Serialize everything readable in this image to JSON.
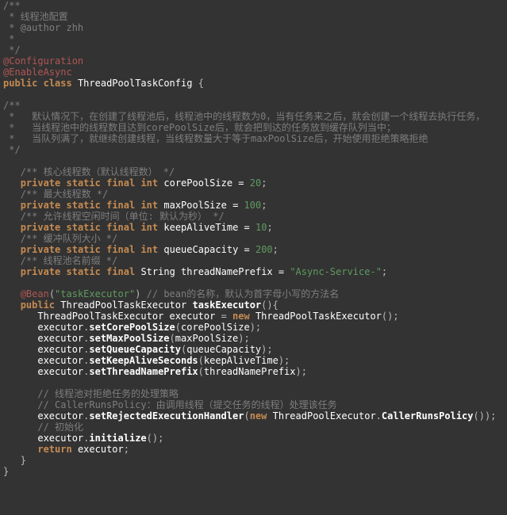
{
  "lines": {
    "c1": "/**",
    "c2": " * 线程池配置",
    "c3": " * @author zhh",
    "c4": " *",
    "c5": " */",
    "ann_conf": "@Configuration",
    "ann_async": "@EnableAsync",
    "kw_public": "public",
    "kw_class": "class",
    "cls_name": "ThreadPoolTaskConfig",
    "brace_o": "{",
    "brace_c": "}",
    "c6": "/**",
    "c7": " *   默认情况下，在创建了线程池后，线程池中的线程数为0，当有任务来之后，就会创建一个线程去执行任务，",
    "c8": " *   当线程池中的线程数目达到corePoolSize后，就会把到达的任务放到缓存队列当中；",
    "c9": " *   当队列满了，就继续创建线程，当线程数量大于等于maxPoolSize后，开始使用拒绝策略拒绝",
    "c10": " */",
    "c_core": "/** 核心线程数（默认线程数） */",
    "kw_private": "private",
    "kw_static": "static",
    "kw_final": "final",
    "ty_int": "int",
    "ty_string": "String",
    "id_core": "corePoolSize",
    "eq": " = ",
    "n20": "20",
    "semi": ";",
    "c_max": "/** 最大线程数 */",
    "id_max": "maxPoolSize",
    "n100": "100",
    "c_alive": "/** 允许线程空闲时间（单位: 默认为秒） */",
    "id_alive": "keepAliveTime",
    "n10": "10",
    "c_queue": "/** 缓冲队列大小 */",
    "id_queue": "queueCapacity",
    "n200": "200",
    "c_prefix": "/** 线程池名前缀 */",
    "id_prefix": "threadNamePrefix",
    "s_prefix": "\"Async-Service-\"",
    "ann_bean": "@Bean",
    "s_bean": "\"taskExecutor\"",
    "c_bean": " // bean的名称，默认为首字母小写的方法名",
    "ret_type": "ThreadPoolTaskExecutor",
    "m_name": "taskExecutor",
    "id_exec": "executor",
    "kw_new": "new",
    "ctor": "ThreadPoolTaskExecutor",
    "call1": "setCorePoolSize",
    "call2": "setMaxPoolSize",
    "call3": "setQueueCapacity",
    "call4": "setKeepAliveSeconds",
    "call5": "setThreadNamePrefix",
    "c_rej1": "// 线程池对拒绝任务的处理策略",
    "c_rej2": "// CallerRunsPolicy：由调用线程（提交任务的线程）处理该任务",
    "call6": "setRejectedExecutionHandler",
    "rej_cls": "ThreadPoolExecutor",
    "rej_inner": "CallerRunsPolicy",
    "c_init": "// 初始化",
    "call7": "initialize",
    "kw_return": "return"
  }
}
